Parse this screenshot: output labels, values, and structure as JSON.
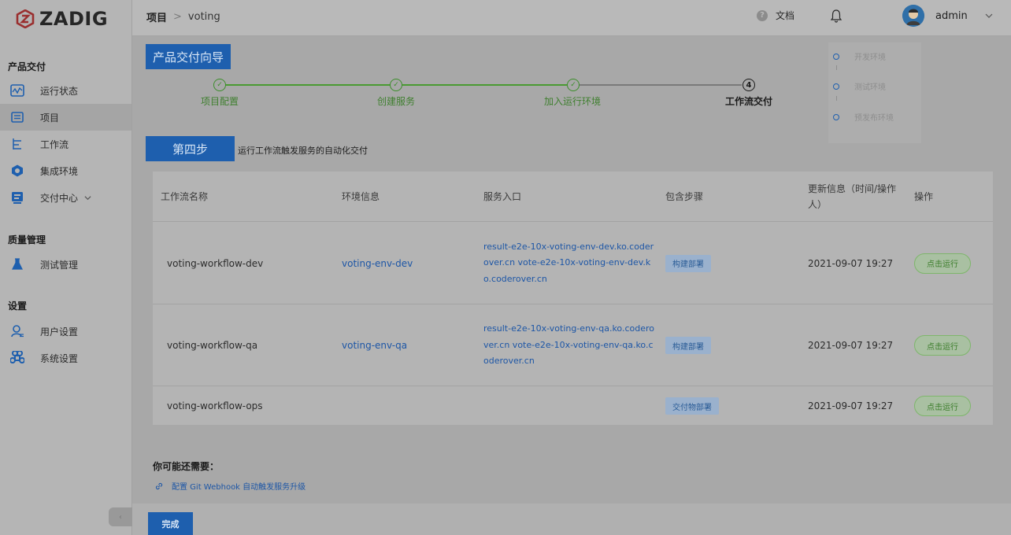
{
  "brand": {
    "name": "ZADIG"
  },
  "sidebar": {
    "sections": [
      {
        "title": "产品交付"
      },
      {
        "title": "质量管理"
      },
      {
        "title": "设置"
      }
    ],
    "items": [
      {
        "label": "运行状态",
        "icon": "activity-icon"
      },
      {
        "label": "项目",
        "icon": "project-icon"
      },
      {
        "label": "工作流",
        "icon": "workflow-icon"
      },
      {
        "label": "集成环境",
        "icon": "environment-icon"
      },
      {
        "label": "交付中心",
        "icon": "delivery-icon"
      },
      {
        "label": "测试管理",
        "icon": "flask-icon"
      },
      {
        "label": "用户设置",
        "icon": "user-settings-icon"
      },
      {
        "label": "系统设置",
        "icon": "command-icon"
      }
    ],
    "collapse_glyph": "‹"
  },
  "topbar": {
    "breadcrumb": {
      "root": "项目",
      "separator": ">",
      "current": "voting"
    },
    "docs_label": "文档",
    "help_glyph": "?",
    "user_name": "admin"
  },
  "wizard": {
    "title": "产品交付向导",
    "steps": [
      {
        "label": "项目配置",
        "marker": "✓"
      },
      {
        "label": "创建服务",
        "marker": "✓"
      },
      {
        "label": "加入运行环境",
        "marker": "✓"
      },
      {
        "label": "工作流交付",
        "marker": "4"
      }
    ],
    "environments": [
      "开发环境",
      "测试环境",
      "预发布环境"
    ],
    "step_badge": "第四步",
    "step_desc": "运行工作流触发服务的自动化交付"
  },
  "table": {
    "headers": {
      "name": "工作流名称",
      "env": "环境信息",
      "entry": "服务入口",
      "steps": "包含步骤",
      "updated": "更新信息（时间/操作人）",
      "action": "操作"
    },
    "rows": [
      {
        "name": "voting-workflow-dev",
        "env": "voting-env-dev",
        "entry": "result-e2e-10x-voting-env-dev.ko.coderover.cn vote-e2e-10x-voting-env-dev.ko.coderover.cn",
        "step": "构建部署",
        "updated": "2021-09-07 19:27",
        "action": "点击运行"
      },
      {
        "name": "voting-workflow-qa",
        "env": "voting-env-qa",
        "entry": "result-e2e-10x-voting-env-qa.ko.coderover.cn vote-e2e-10x-voting-env-qa.ko.coderover.cn",
        "step": "构建部署",
        "updated": "2021-09-07 19:27",
        "action": "点击运行"
      },
      {
        "name": "voting-workflow-ops",
        "env": "",
        "entry": "",
        "step": "交付物部署",
        "updated": "2021-09-07 19:27",
        "action": "点击运行"
      }
    ]
  },
  "more": {
    "title": "你可能还需要：",
    "link": "配置 Git Webhook 自动触发服务升级"
  },
  "footer": {
    "done_label": "完成"
  },
  "colors": {
    "accent": "#1e5fae",
    "success": "#3b8e2a",
    "link": "#1d56a6"
  }
}
